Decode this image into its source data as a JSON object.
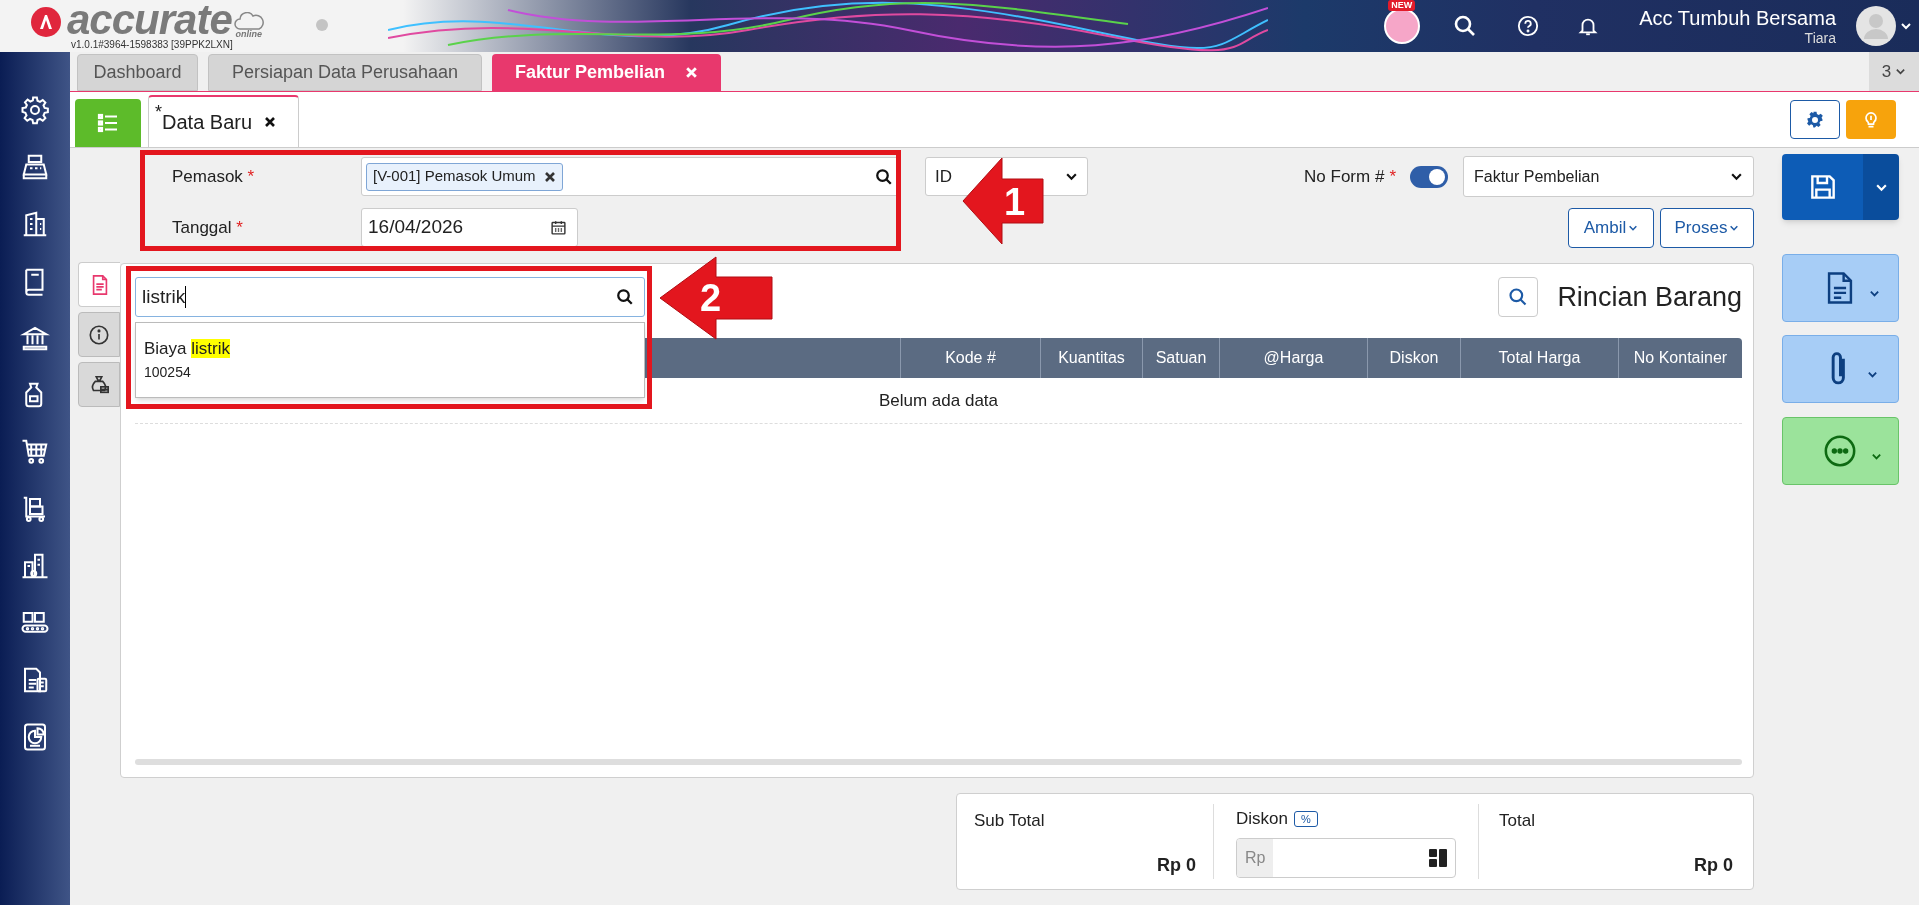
{
  "header": {
    "logo": "accurate",
    "logo_sub": "online",
    "version": "v1.0.1#3964-1598383 [39PPK2LXN]",
    "new_badge": "NEW",
    "company": "Acc Tumbuh Bersama",
    "user": "Tiara"
  },
  "tabs": [
    {
      "label": "Dashboard",
      "selected": false,
      "closable": false
    },
    {
      "label": "Persiapan Data Perusahaan",
      "selected": false,
      "closable": false
    },
    {
      "label": "Faktur Pembelian",
      "selected": true,
      "closable": true
    }
  ],
  "tab_count": "3",
  "subtab": {
    "mark": "*",
    "label": "Data Baru",
    "selected": true
  },
  "form": {
    "supplier": {
      "label": "Pemasok",
      "required_mark": "*",
      "tag": "[V-001] Pemasok Umum"
    },
    "currency": {
      "value": "ID"
    },
    "form_number": {
      "label": "No Form #",
      "required_mark": "*",
      "on": true,
      "value": "Faktur Pembelian"
    },
    "date": {
      "label": "Tanggal",
      "required_mark": "*",
      "value": "16/04/2026"
    },
    "buttons": [
      "Ambil",
      "Proses"
    ]
  },
  "side_tabs": [
    {
      "kind": "document",
      "selected": true
    },
    {
      "kind": "info",
      "selected": false
    },
    {
      "kind": "money",
      "selected": false
    }
  ],
  "item_search": {
    "value": "listrik",
    "results": [
      {
        "name": "Biaya",
        "match": "listrik",
        "code": "100254"
      }
    ]
  },
  "table": {
    "title": "Rincian Barang",
    "columns": [
      "Kode #",
      "Kuantitas",
      "Satuan",
      "@Harga",
      "Diskon",
      "Total Harga",
      "No Kontainer"
    ],
    "empty_text": "Belum ada data"
  },
  "totals": {
    "subtotal": {
      "label": "Sub Total",
      "value": "Rp 0"
    },
    "discount": {
      "label": "Diskon",
      "toggle": "%",
      "prefix": "Rp"
    },
    "total": {
      "label": "Total",
      "value": "Rp 0"
    }
  },
  "annotations": [
    {
      "number": "1"
    },
    {
      "number": "2"
    }
  ]
}
